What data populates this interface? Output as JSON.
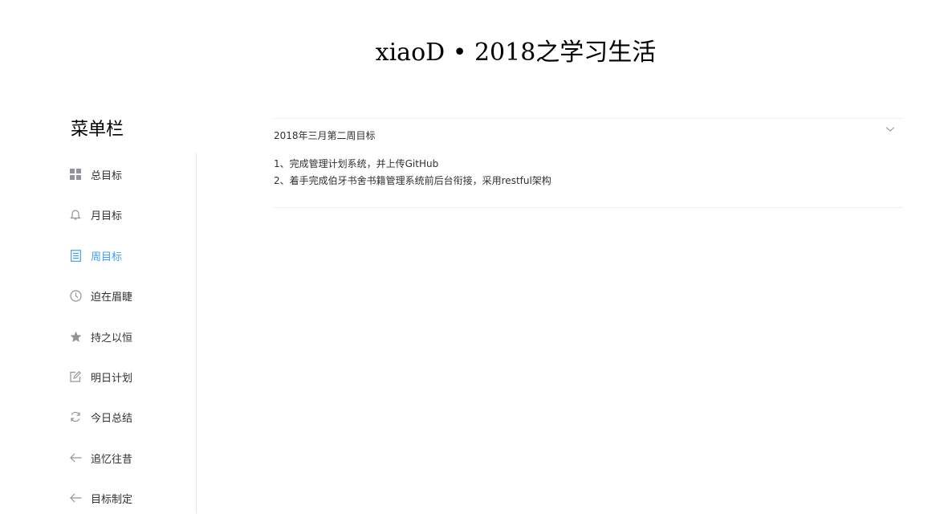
{
  "header": {
    "title": "xiaoD • 2018之学习生活"
  },
  "sidebar": {
    "title": "菜单栏",
    "active_color": "#409eff",
    "items": [
      {
        "label": "总目标",
        "icon": "grid-icon"
      },
      {
        "label": "月目标",
        "icon": "bell-icon"
      },
      {
        "label": "周目标",
        "icon": "document-icon"
      },
      {
        "label": "迫在眉睫",
        "icon": "clock-icon"
      },
      {
        "label": "持之以恒",
        "icon": "star-icon"
      },
      {
        "label": "明日计划",
        "icon": "edit-icon"
      },
      {
        "label": "今日总结",
        "icon": "refresh-icon"
      },
      {
        "label": "追忆往昔",
        "icon": "arrow-left-icon"
      },
      {
        "label": "目标制定",
        "icon": "arrow-left-icon"
      }
    ]
  },
  "main": {
    "panel": {
      "title": "2018年三月第二周目标",
      "lines": [
        "1、完成管理计划系统，并上传GitHub",
        "2、着手完成伯牙书舍书籍管理系统前后台衔接，采用restful架构"
      ]
    }
  }
}
